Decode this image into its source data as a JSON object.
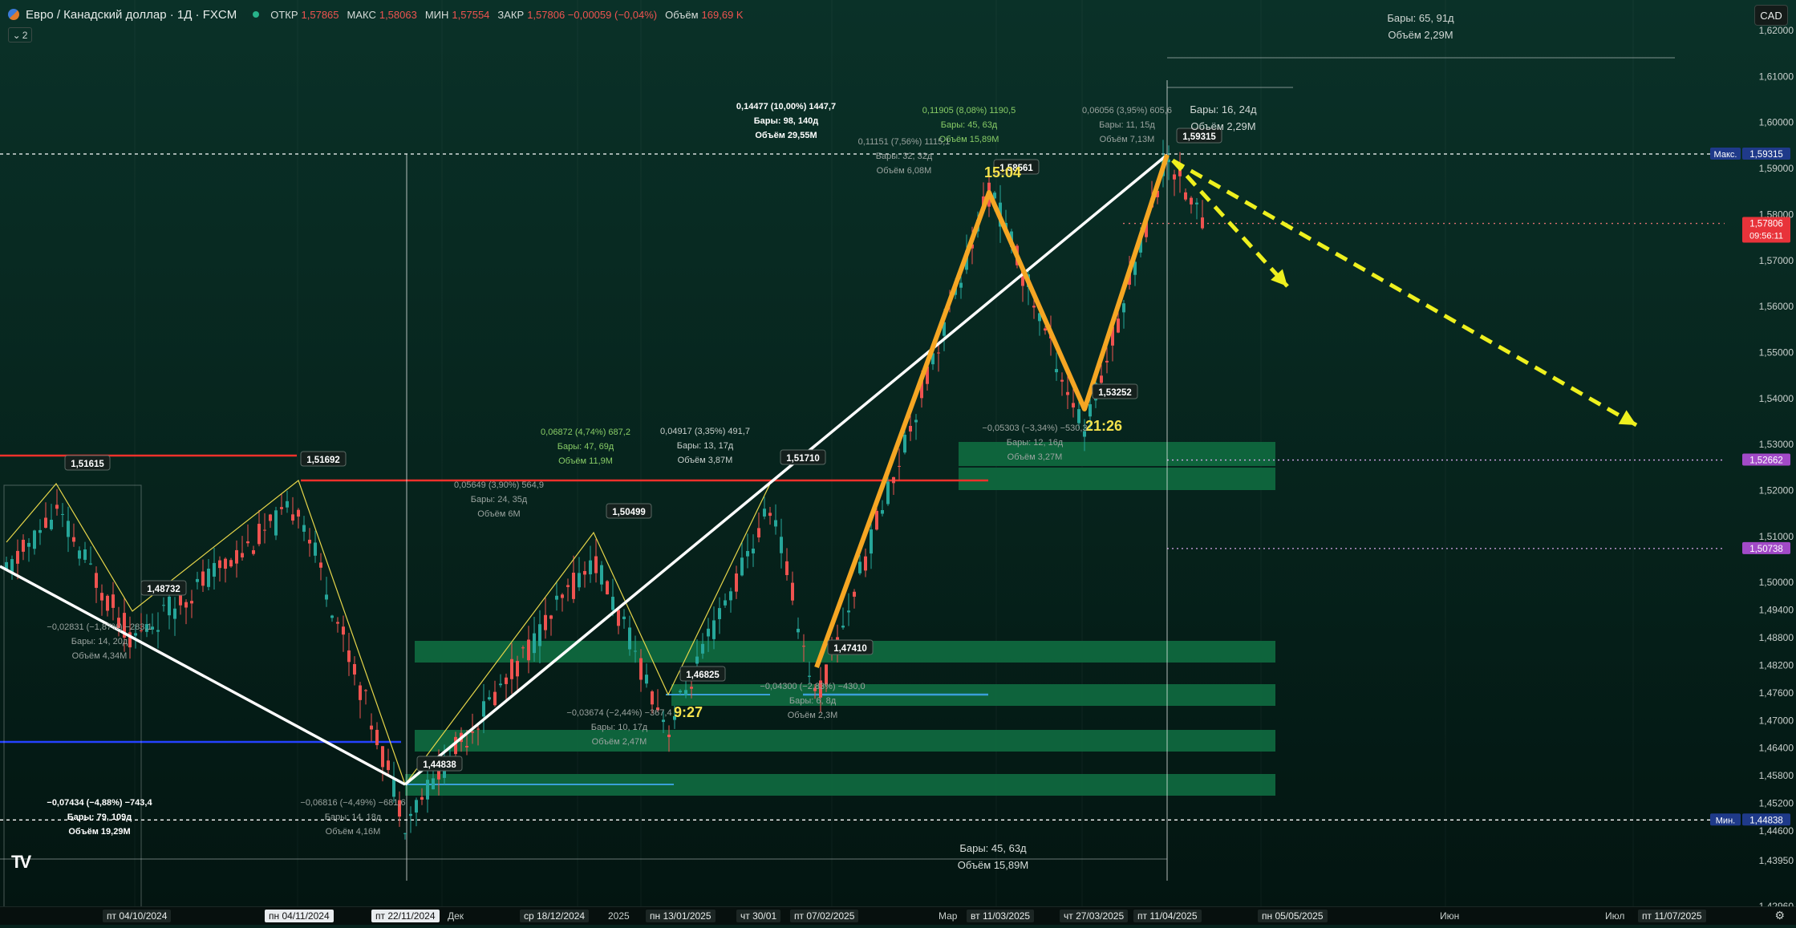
{
  "header": {
    "title": "Евро / Канадский доллар · 1Д · FXCM",
    "ohlc": [
      {
        "k": "ОТКР",
        "v": "1,57865"
      },
      {
        "k": "МАКС",
        "v": "1,58063"
      },
      {
        "k": "МИН",
        "v": "1,57554"
      },
      {
        "k": "ЗАКР",
        "v": "1,57806 −0,00059 (−0,04%)"
      },
      {
        "k": "Объём",
        "v": "169,69 K"
      }
    ],
    "indicator_count": "2",
    "currency": "CAD"
  },
  "colors": {
    "background": "#07231d",
    "zigzag": "#f5a623",
    "trendline": "#ffffff",
    "arrow": "#eef01e",
    "up_candle": "#26a69a",
    "down_candle": "#ef5350",
    "zone": "#0f6b40",
    "red_level": "#f0312b",
    "blue_level": "#2442ff",
    "cyan_level": "#3aa0d8"
  },
  "chart_data": {
    "type": "candlestick",
    "instrument": "EURCAD",
    "timeframe": "1Д",
    "ylim": [
      1.4296,
      1.62
    ],
    "price_ticks": [
      "1,62000",
      "1,61000",
      "1,60000",
      "1,59000",
      "1,58000",
      "1,57000",
      "1,56000",
      "1,55000",
      "1,54000",
      "1,53000",
      "1,52000",
      "1,51000",
      "1,50000",
      "1,49400",
      "1,48800",
      "1,48200",
      "1,47600",
      "1,47000",
      "1,46400",
      "1,45800",
      "1,45200",
      "1,44600",
      "1,43950",
      "1,42960"
    ],
    "price_badges": [
      {
        "label": "Макс.",
        "value": "1,59315",
        "color": "#1f3a8a"
      },
      {
        "label": "",
        "value": "1,57806",
        "sub": "09:56:11",
        "color": "#e8333a"
      },
      {
        "label": "",
        "value": "1,52662",
        "color": "#a24ac8"
      },
      {
        "label": "",
        "value": "1,50738",
        "color": "#a24ac8"
      },
      {
        "label": "Мин.",
        "value": "1,44838",
        "color": "#1f3a8a"
      }
    ],
    "time_labels": [
      {
        "text": "пт 04/10/2024",
        "style": "dk"
      },
      {
        "text": "пн 04/11/2024",
        "style": "hl"
      },
      {
        "text": "пт 22/11/2024",
        "style": "hl"
      },
      {
        "text": "Дек",
        "style": ""
      },
      {
        "text": "ср 18/12/2024",
        "style": "dk"
      },
      {
        "text": "2025",
        "style": ""
      },
      {
        "text": "пн 13/01/2025",
        "style": "dk"
      },
      {
        "text": "чт 30/01",
        "style": "dk"
      },
      {
        "text": "пт 07/02/2025",
        "style": "dk"
      },
      {
        "text": "Мар",
        "style": ""
      },
      {
        "text": "вт 11/03/2025",
        "style": "dk"
      },
      {
        "text": "чт 27/03/2025",
        "style": "dk"
      },
      {
        "text": "пт 11/04/2025",
        "style": "dk"
      },
      {
        "text": "пн 05/05/2025",
        "style": "dk"
      },
      {
        "text": "Июн",
        "style": ""
      },
      {
        "text": "Июл",
        "style": ""
      },
      {
        "text": "пт 11/07/2025",
        "style": "dk"
      }
    ],
    "swing_points": [
      {
        "price": "1,51615"
      },
      {
        "price": "1,48732"
      },
      {
        "price": "1,51692"
      },
      {
        "price": "1,44838"
      },
      {
        "price": "1,50499"
      },
      {
        "price": "1,46825"
      },
      {
        "price": "1,51710"
      },
      {
        "price": "1,47410"
      },
      {
        "price": "1,58561"
      },
      {
        "price": "1,53252"
      },
      {
        "price": "1,59315"
      }
    ],
    "time_marks": [
      "15:04",
      "9:27",
      "21:26"
    ],
    "measurements": [
      {
        "lines": [
          "0,14477 (10,00%) 1447,7",
          "Бары: 98, 140д",
          "Объём 29,55M"
        ]
      },
      {
        "lines": [
          "0,11905 (8,08%) 1190,5",
          "Бары: 45, 63д",
          "Объём 15,89M"
        ]
      },
      {
        "lines": [
          "0,06056 (3,95%) 605,6",
          "Бары: 11, 15д",
          "Объём 7,13M"
        ]
      },
      {
        "lines": [
          "0,11151 (7,56%) 1115,1",
          "Бары: 32, 32д",
          "Объём 6,08M"
        ]
      },
      {
        "lines": [
          "Бары: 65, 91д",
          "Объём 2,29M"
        ]
      },
      {
        "lines": [
          "Бары: 16, 24д",
          "Объём 2,29M"
        ]
      },
      {
        "lines": [
          "0,06872 (4,74%) 687,2",
          "Бары: 47, 69д",
          "Объём 11,9M"
        ]
      },
      {
        "lines": [
          "0,04917 (3,35%) 491,7",
          "Бары: 13, 17д",
          "Объём 3,87M"
        ]
      },
      {
        "lines": [
          "0,05649 (3,90%) 564,9",
          "Бары: 24, 35д",
          "Объём 6M"
        ]
      },
      {
        "lines": [
          "−0,02831 (−1,87%) −283,1",
          "Бары: 14, 20д",
          "Объём 4,34M"
        ]
      },
      {
        "lines": [
          "−0,07434 (−4,88%) −743,4",
          "Бары: 79, 109д",
          "Объём 19,29M"
        ]
      },
      {
        "lines": [
          "−0,06816 (−4,49%) −681,6",
          "Бары: 14, 18д",
          "Объём 4,16M"
        ]
      },
      {
        "lines": [
          "−0,03674 (−2,44%) −367,4",
          "Бары: 10, 17д",
          "Объём 2,47M"
        ]
      },
      {
        "lines": [
          "−0,04300 (−2,83%) −430,0",
          "Бары: 6, 8д",
          "Объём 2,3M"
        ]
      },
      {
        "lines": [
          "−0,05303 (−3,34%) −530,3",
          "Бары: 12, 16д",
          "Объём 3,27M"
        ]
      },
      {
        "lines": [
          "Бары: 45, 63д",
          "Объём 15,89M"
        ]
      }
    ]
  }
}
